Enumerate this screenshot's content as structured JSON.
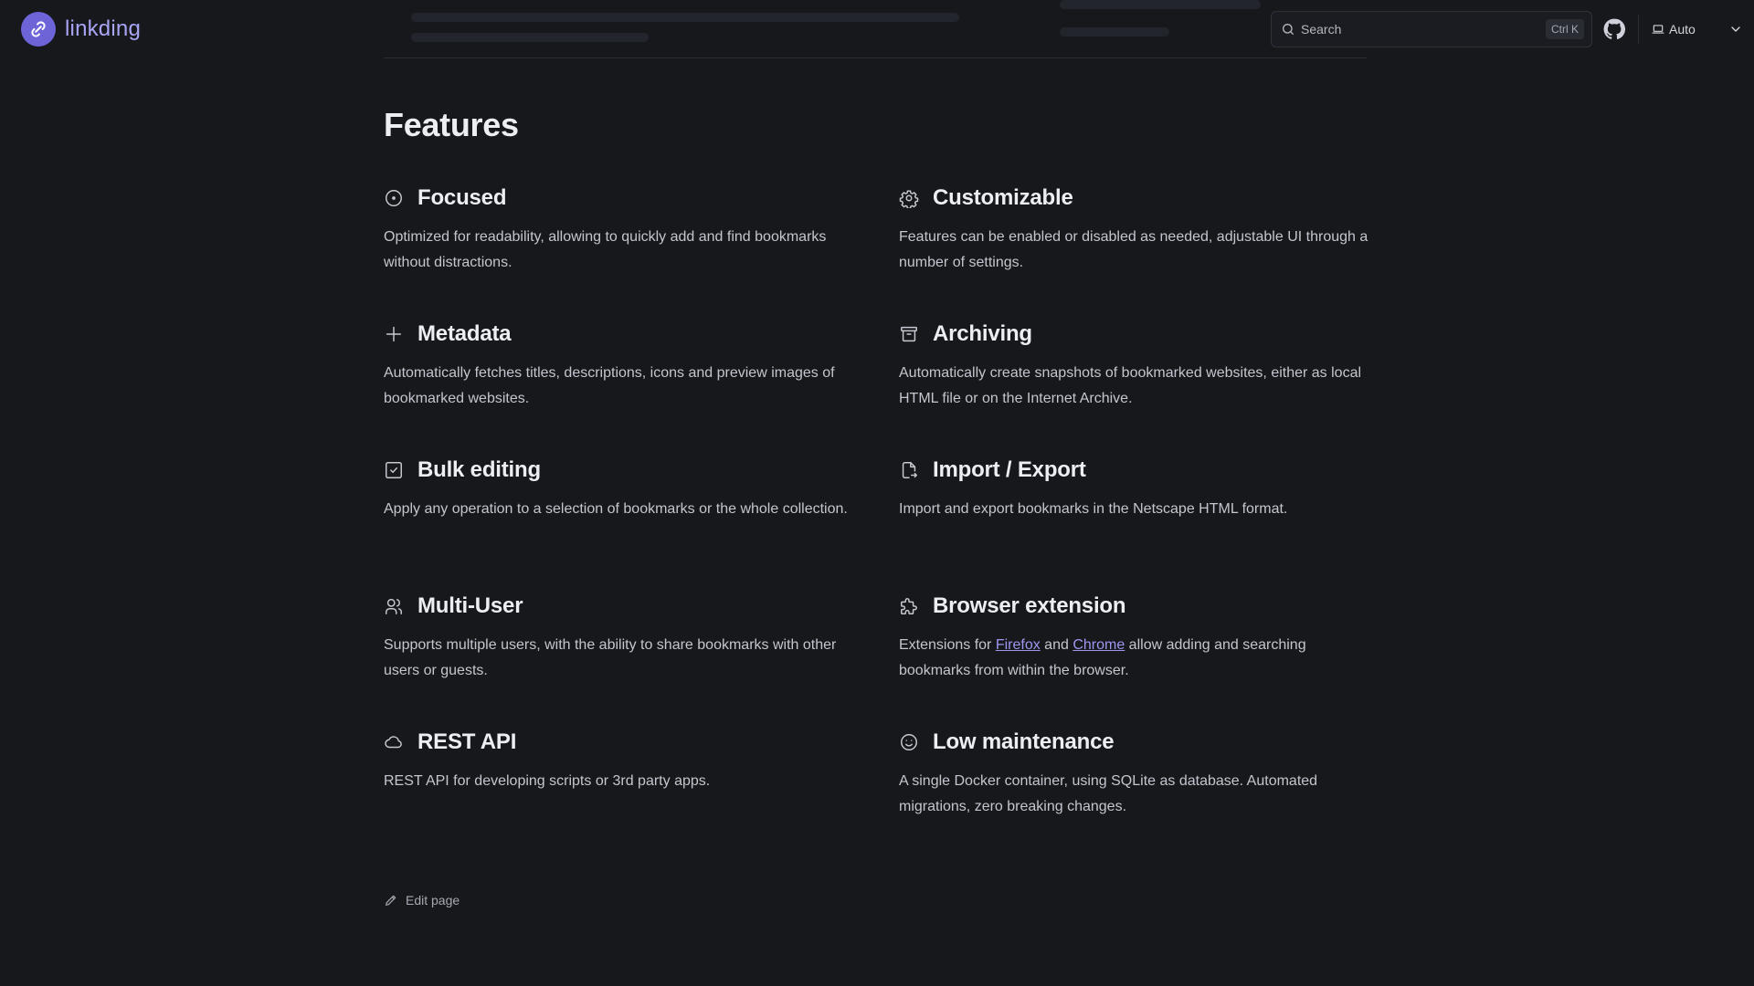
{
  "brand": {
    "name": "linkding"
  },
  "header": {
    "search_label": "Search",
    "search_shortcut": "Ctrl K",
    "theme_label": "Auto"
  },
  "main": {
    "title": "Features",
    "features": [
      {
        "title": "Focused",
        "icon": "circle-dot-icon",
        "desc": "Optimized for readability, allowing to quickly add and find bookmarks without distractions."
      },
      {
        "title": "Customizable",
        "icon": "gear-icon",
        "desc": "Features can be enabled or disabled as needed, adjustable UI through a number of settings."
      },
      {
        "title": "Metadata",
        "icon": "plus-icon",
        "desc": "Automatically fetches titles, descriptions, icons and preview images of bookmarked websites."
      },
      {
        "title": "Archiving",
        "icon": "archive-icon",
        "desc": "Automatically create snapshots of bookmarked websites, either as local HTML file or on the Internet Archive."
      },
      {
        "title": "Bulk editing",
        "icon": "checkbox-icon",
        "desc": "Apply any operation to a selection of bookmarks or the whole collection."
      },
      {
        "title": "Import / Export",
        "icon": "file-export-icon",
        "desc": "Import and export bookmarks in the Netscape HTML format."
      },
      {
        "title": "Multi-User",
        "icon": "users-icon",
        "desc": "Supports multiple users, with the ability to share bookmarks with other users or guests."
      },
      {
        "title": "Browser extension",
        "icon": "puzzle-icon",
        "desc_prefix": "Extensions for ",
        "link1": "Firefox",
        "desc_mid": " and ",
        "link2": "Chrome",
        "desc_suffix": " allow adding and searching bookmarks from within the browser."
      },
      {
        "title": "REST API",
        "icon": "cloud-icon",
        "desc": "REST API for developing scripts or 3rd party apps."
      },
      {
        "title": "Low maintenance",
        "icon": "smiley-icon",
        "desc": "A single Docker container, using SQLite as database. Automated migrations, zero breaking changes."
      }
    ]
  },
  "footer": {
    "edit_label": "Edit page"
  }
}
